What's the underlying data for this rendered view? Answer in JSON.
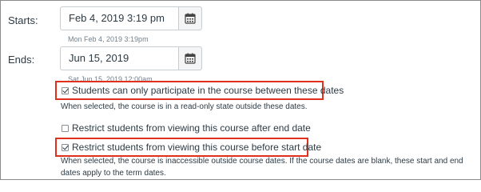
{
  "starts": {
    "label": "Starts:",
    "value": "Feb 4, 2019 3:19 pm",
    "hint": "Mon Feb 4, 2019 3:19pm"
  },
  "ends": {
    "label": "Ends:",
    "value": "Jun 15, 2019",
    "hint": "Sat Jun 15, 2019 12:00am"
  },
  "options": {
    "between_dates": {
      "label": "Students can only participate in the course between these dates",
      "checked": true,
      "description": "When selected, the course is in a read-only state outside these dates."
    },
    "restrict_after_end": {
      "label": "Restrict students from viewing this course after end date",
      "checked": false
    },
    "restrict_before_start": {
      "label": "Restrict students from viewing this course before start date",
      "checked": true,
      "description": "When selected, the course is inaccessible outside course dates. If the course dates are blank, these start and end dates apply to the term dates."
    }
  },
  "icons": {
    "calendar": "calendar-icon"
  },
  "colors": {
    "highlight": "#e0301e",
    "text": "#2d3b45",
    "hint": "#73818c"
  }
}
